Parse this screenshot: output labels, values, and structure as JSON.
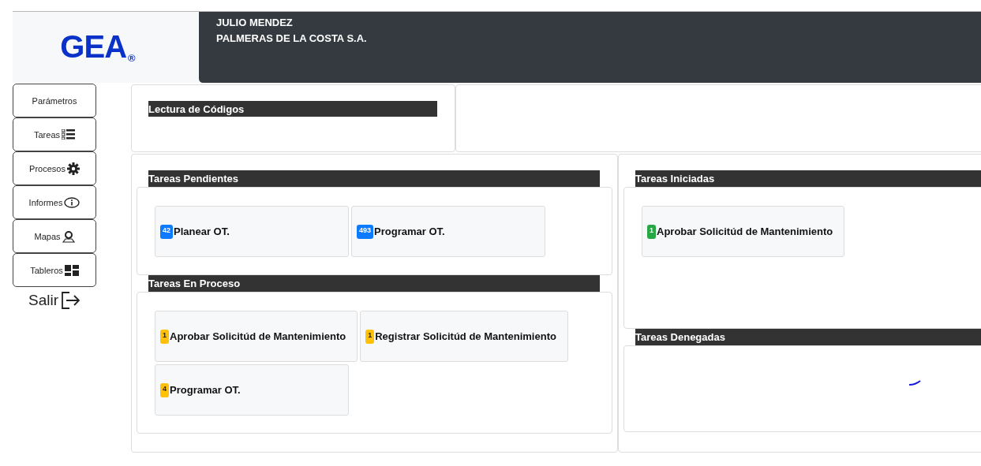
{
  "logo": {
    "text": "GEA",
    "mark": "®"
  },
  "header": {
    "user": "JULIO MENDEZ",
    "company": "PALMERAS DE LA COSTA S.A."
  },
  "sidebar": {
    "items": [
      {
        "label": "Parámetros"
      },
      {
        "label": "Tareas"
      },
      {
        "label": "Procesos"
      },
      {
        "label": "Informes"
      },
      {
        "label": "Mapas"
      },
      {
        "label": "Tableros"
      }
    ],
    "logout": "Salir"
  },
  "code_reader": {
    "title": "Lectura de Códigos"
  },
  "columns": [
    {
      "sections": [
        {
          "title": "Tareas Pendientes",
          "loading": false,
          "tasks": [
            {
              "count": "42",
              "label": "Planear OT.",
              "color": "#0d7bff"
            },
            {
              "count": "493",
              "label": "Programar OT.",
              "color": "#0d7bff"
            }
          ]
        },
        {
          "title": "Tareas En Proceso",
          "loading": false,
          "tasks": [
            {
              "count": "1",
              "label": "Aprobar Solicitúd de Mantenimiento",
              "color": "#ffc107"
            },
            {
              "count": "1",
              "label": "Registrar Solicitúd de Mantenimiento",
              "color": "#ffc107"
            },
            {
              "count": "4",
              "label": "Programar OT.",
              "color": "#ffc107"
            }
          ]
        }
      ]
    },
    {
      "sections": [
        {
          "title": "Tareas Iniciadas",
          "loading": false,
          "tasks": [
            {
              "count": "1",
              "label": "Aprobar Solicitúd de Mantenimiento",
              "color": "#28a745"
            }
          ]
        },
        {
          "title": "Tareas Denegadas",
          "loading": true
        }
      ]
    }
  ]
}
